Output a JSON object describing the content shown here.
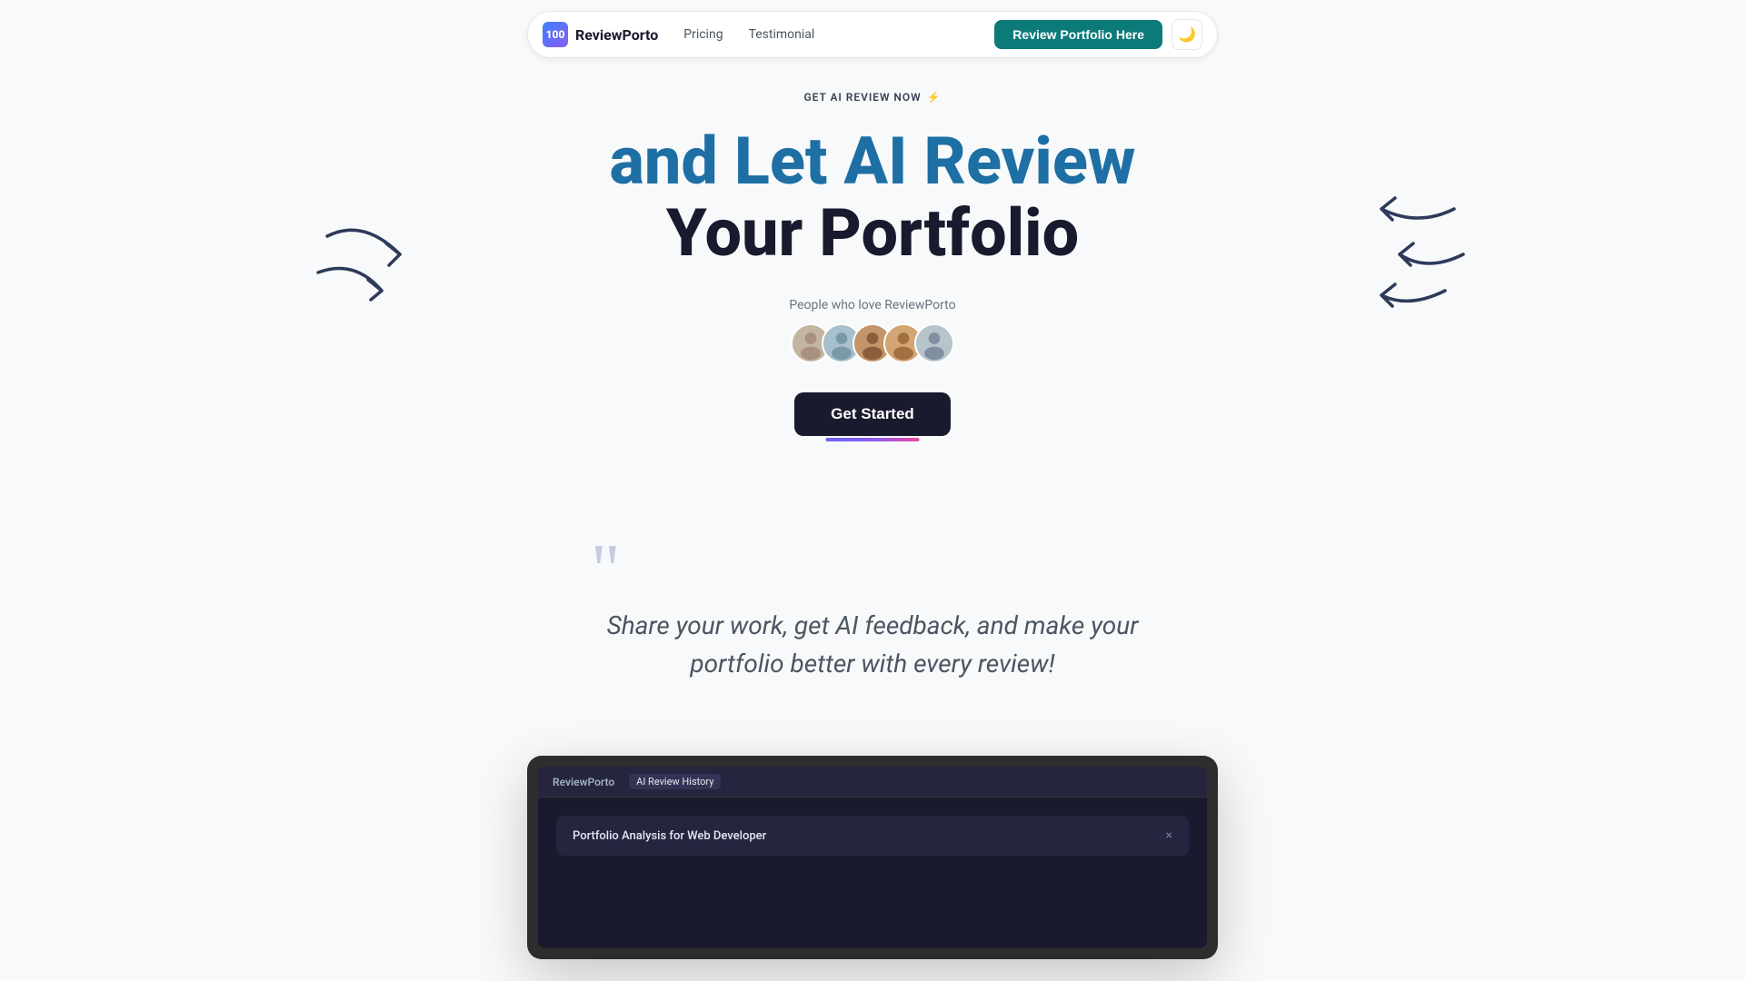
{
  "nav": {
    "logo_icon": "100",
    "logo_text": "ReviewPorto",
    "links": [
      {
        "label": "Pricing",
        "id": "pricing"
      },
      {
        "label": "Testimonial",
        "id": "testimonial"
      }
    ],
    "cta_button": "Review Portfolio Here",
    "theme_icon": "🌙"
  },
  "hero": {
    "badge_text": "GET AI REVIEW NOW",
    "badge_icon": "⚡",
    "heading_line1": "and Let AI Review",
    "heading_line2": "Your Portfolio",
    "social_proof_label": "People who love ReviewPorto",
    "avatars": [
      {
        "id": 1,
        "label": "user1"
      },
      {
        "id": 2,
        "label": "user2"
      },
      {
        "id": 3,
        "label": "user3"
      },
      {
        "id": 4,
        "label": "user4"
      },
      {
        "id": 5,
        "label": "user5"
      }
    ],
    "cta_button": "Get Started"
  },
  "quote": {
    "text": "Share your work, get AI feedback, and make your portfolio better with every review!",
    "marks": "““"
  },
  "mockup": {
    "logo": "ReviewPorto",
    "tabs": [
      {
        "label": "AI Review History",
        "active": true
      }
    ],
    "card_title": "Portfolio Analysis for Web Developer",
    "close_icon": "×"
  },
  "colors": {
    "accent_teal": "#0d7a7a",
    "heading_blue": "#1d6fa4",
    "dark": "#1a1a2e",
    "gradient_start": "#6366f1",
    "gradient_end": "#ec4899"
  }
}
